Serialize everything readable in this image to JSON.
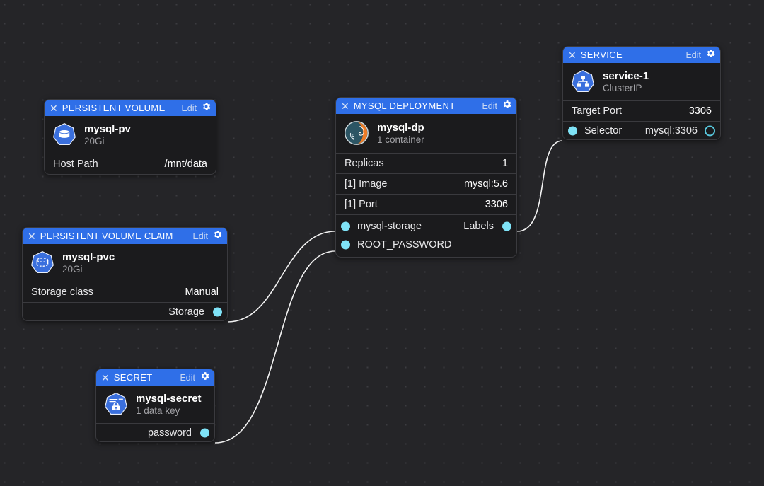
{
  "canvas": {
    "background_color": "#252528",
    "grid_dot_color": "#3c3c40",
    "edge_color": "#f2f2f2",
    "accent_color": "#2f6fe8",
    "port_color": "#7fe3f7"
  },
  "nodes": {
    "persistent_volume": {
      "title": "PERSISTENT VOLUME",
      "close_label": "✕",
      "edit_label": "Edit",
      "icon": "k8s-persistent-volume-icon",
      "name": "mysql-pv",
      "subtitle": "20Gi",
      "rows": [
        {
          "key": "Host Path",
          "value": "/mnt/data"
        }
      ]
    },
    "persistent_volume_claim": {
      "title": "PERSISTENT VOLUME CLAIM",
      "close_label": "✕",
      "edit_label": "Edit",
      "icon": "k8s-persistent-volume-claim-icon",
      "name": "mysql-pvc",
      "subtitle": "20Gi",
      "rows": [
        {
          "key": "Storage class",
          "value": "Manual"
        }
      ],
      "ports": [
        {
          "label": "Storage",
          "side": "right",
          "style": "filled"
        }
      ]
    },
    "mysql_deployment": {
      "title": "MYSQL DEPLOYMENT",
      "close_label": "✕",
      "edit_label": "Edit",
      "icon": "mysql-dolphin-icon",
      "name": "mysql-dp",
      "subtitle": "1 container",
      "rows": [
        {
          "key": "Replicas",
          "value": "1"
        },
        {
          "key": "[1] Image",
          "value": "mysql:5.6"
        },
        {
          "key": "[1] Port",
          "value": "3306"
        }
      ],
      "ports": [
        {
          "label": "mysql-storage",
          "side": "left",
          "style": "filled"
        },
        {
          "label": "Labels",
          "side": "right",
          "style": "filled"
        },
        {
          "label": "ROOT_PASSWORD",
          "side": "left",
          "style": "filled"
        }
      ]
    },
    "service": {
      "title": "SERVICE",
      "close_label": "✕",
      "edit_label": "Edit",
      "icon": "k8s-service-icon",
      "name": "service-1",
      "subtitle": "ClusterIP",
      "rows": [
        {
          "key": "Target Port",
          "value": "3306"
        }
      ],
      "ports": [
        {
          "label": "Selector",
          "value": "mysql:3306",
          "side": "left",
          "style": "filled"
        },
        {
          "label": "",
          "side": "right",
          "style": "hollow"
        }
      ]
    },
    "secret": {
      "title": "SECRET",
      "close_label": "✕",
      "edit_label": "Edit",
      "icon": "k8s-secret-icon",
      "name": "mysql-secret",
      "subtitle": "1 data key",
      "ports": [
        {
          "label": "password",
          "side": "right",
          "style": "filled"
        }
      ]
    }
  },
  "connections": [
    {
      "from": "persistent_volume_claim.Storage",
      "to": "mysql_deployment.mysql-storage"
    },
    {
      "from": "secret.password",
      "to": "mysql_deployment.ROOT_PASSWORD"
    },
    {
      "from": "mysql_deployment.Labels",
      "to": "service.Selector"
    }
  ]
}
